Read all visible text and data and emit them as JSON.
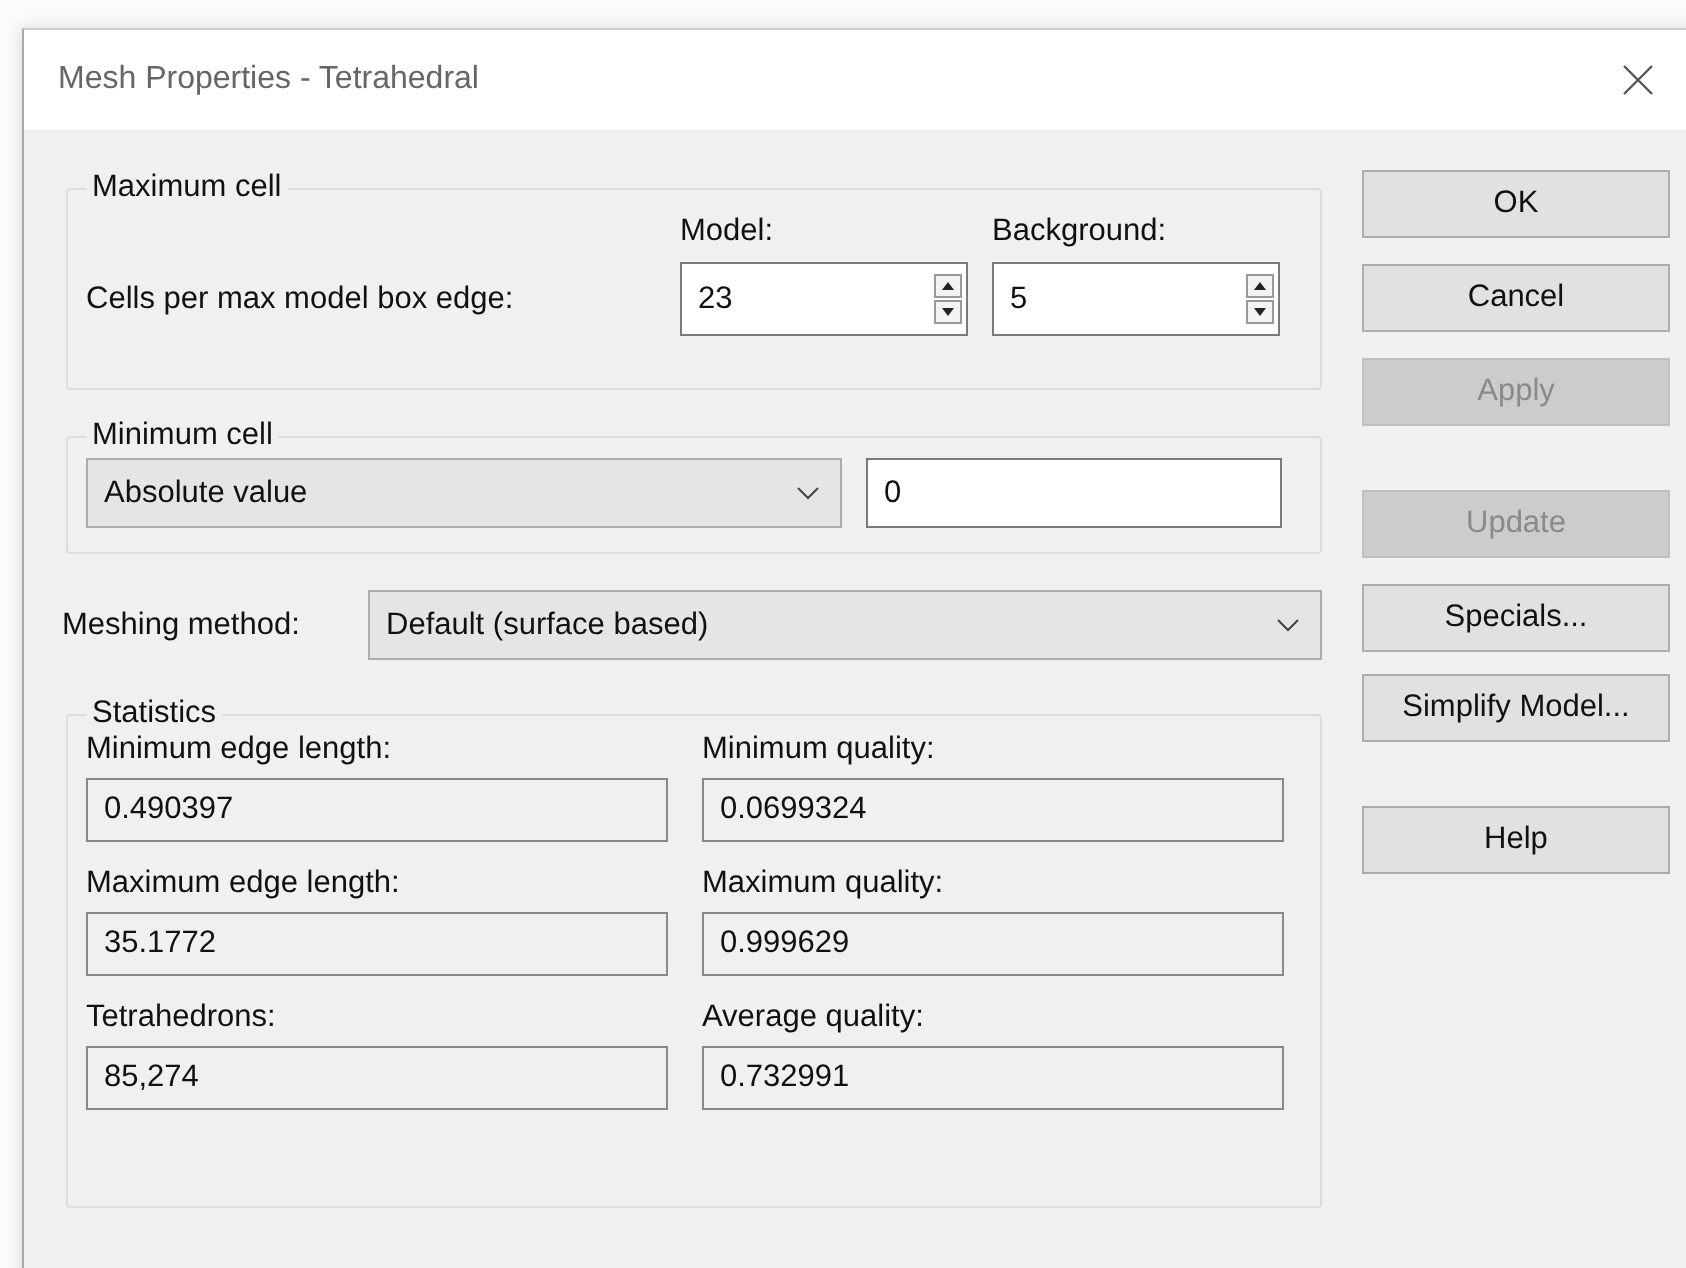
{
  "window": {
    "title": "Mesh Properties - Tetrahedral"
  },
  "maximum_cell": {
    "legend": "Maximum cell",
    "columns": [
      "Model:",
      "Background:"
    ],
    "row_label": "Cells per max model box edge:",
    "spinners": [
      {
        "value": "23"
      },
      {
        "value": "5"
      }
    ]
  },
  "minimum_cell": {
    "legend": "Minimum cell",
    "mode": "Absolute value",
    "value": "0"
  },
  "meshing_method": {
    "label": "Meshing method:",
    "value": "Default (surface based)"
  },
  "statistics": {
    "legend": "Statistics",
    "items": [
      {
        "label": "Minimum edge length:",
        "value": "0.490397"
      },
      {
        "label": "Minimum quality:",
        "value": "0.0699324"
      },
      {
        "label": "Maximum edge length:",
        "value": "35.1772"
      },
      {
        "label": "Maximum quality:",
        "value": "0.999629"
      },
      {
        "label": "Tetrahedrons:",
        "value": "85,274"
      },
      {
        "label": "Average quality:",
        "value": "0.732991"
      }
    ]
  },
  "buttons": [
    {
      "label": "OK",
      "disabled": false
    },
    {
      "label": "Cancel",
      "disabled": false
    },
    {
      "label": "Apply",
      "disabled": true
    },
    {
      "label": "Update",
      "disabled": true
    },
    {
      "label": "Specials...",
      "disabled": false
    },
    {
      "label": "Simplify Model...",
      "disabled": false
    },
    {
      "label": "Help",
      "disabled": false
    }
  ]
}
